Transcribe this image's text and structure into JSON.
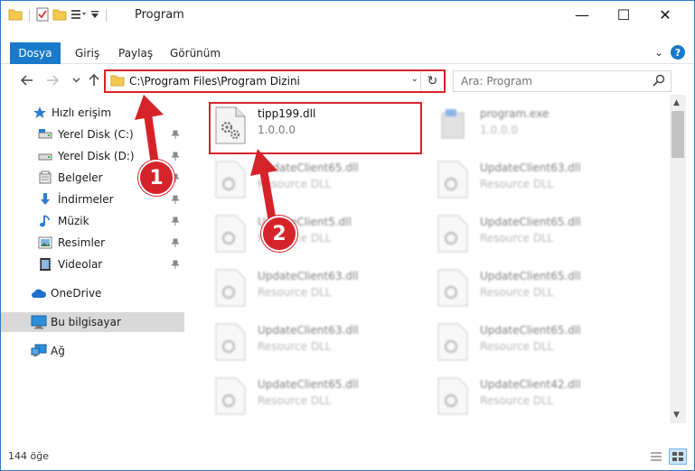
{
  "window": {
    "title": "Program",
    "controls": {
      "minimize": "—",
      "maximize": "☐",
      "close": "✕",
      "expand": "⌄"
    }
  },
  "ribbon": {
    "file_tab": "Dosya",
    "tabs": [
      "Giriş",
      "Paylaş",
      "Görünüm"
    ],
    "help": "?"
  },
  "address": {
    "path": "C:\\Program Files\\Program Dizini",
    "dropdown": "⌄",
    "refresh": "↻"
  },
  "search": {
    "placeholder": "Ara: Program"
  },
  "sidebar": {
    "items": [
      {
        "label": "Hızlı erişim",
        "icon": "star-icon"
      },
      {
        "label": "Yerel Disk (C:)",
        "icon": "drive-icon"
      },
      {
        "label": "Yerel Disk (D:)",
        "icon": "drive-icon"
      },
      {
        "label": "Belgeler",
        "icon": "documents-icon"
      },
      {
        "label": "İndirmeler",
        "icon": "download-icon"
      },
      {
        "label": "Müzik",
        "icon": "music-icon"
      },
      {
        "label": "Resimler",
        "icon": "pictures-icon"
      },
      {
        "label": "Videolar",
        "icon": "video-icon"
      },
      {
        "label": "OneDrive",
        "icon": "cloud-icon"
      },
      {
        "label": "Bu bilgisayar",
        "icon": "computer-icon"
      },
      {
        "label": "Ağ",
        "icon": "network-icon"
      }
    ]
  },
  "files": [
    {
      "name": "tipp199.dll",
      "desc": "1.0.0.0"
    },
    {
      "name": "program.exe",
      "desc": "1.0.0.0"
    },
    {
      "name": "UpdateClient65.dll",
      "desc": "Resource DLL"
    },
    {
      "name": "UpdateClient63.dll",
      "desc": "Resource DLL"
    },
    {
      "name": "UpdateClient5.dll",
      "desc": "Resource DLL"
    },
    {
      "name": "UpdateClient65.dll",
      "desc": "Resource DLL"
    },
    {
      "name": "UpdateClient63.dll",
      "desc": "Resource DLL"
    },
    {
      "name": "UpdateClient65.dll",
      "desc": "Resource DLL"
    },
    {
      "name": "UpdateClient63.dll",
      "desc": "Resource DLL"
    },
    {
      "name": "UpdateClient65.dll",
      "desc": "Resource DLL"
    },
    {
      "name": "UpdateClient65.dll",
      "desc": "Resource DLL"
    },
    {
      "name": "UpdateClient42.dll",
      "desc": "Resource DLL"
    }
  ],
  "status": {
    "count": "144 öğe"
  },
  "callouts": {
    "one": "1",
    "two": "2"
  },
  "colors": {
    "accent": "#1979ca",
    "annotation": "#d6232a",
    "selected": "#d9d9d9"
  }
}
